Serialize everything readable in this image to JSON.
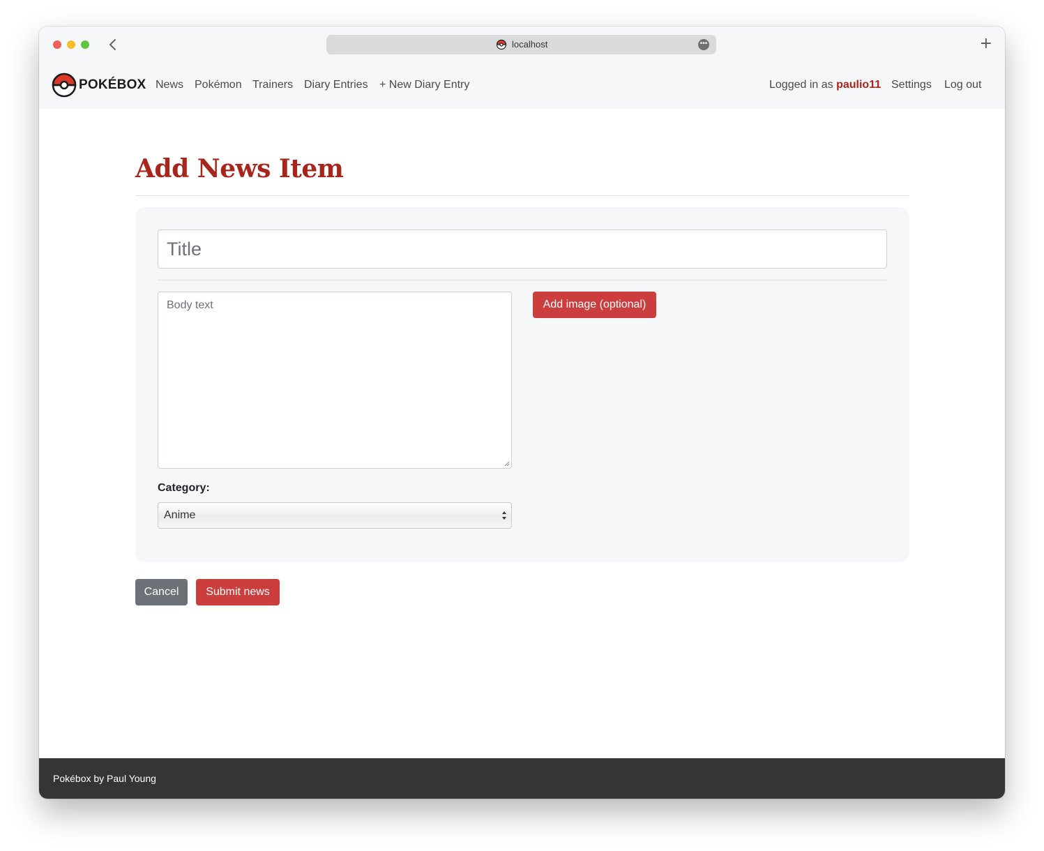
{
  "browser": {
    "url": "localhost",
    "new_tab_label": "+",
    "more_label": "•••"
  },
  "navbar": {
    "brand": "POKÉBOX",
    "links": [
      {
        "label": "News"
      },
      {
        "label": "Pokémon"
      },
      {
        "label": "Trainers"
      },
      {
        "label": "Diary Entries"
      },
      {
        "label": "New Diary Entry",
        "icon": "plus-icon",
        "prefix": "+"
      }
    ],
    "logged_in_prefix": "Logged in as",
    "username": "paulio11",
    "settings_label": "Settings",
    "logout_label": "Log out"
  },
  "page": {
    "title": "Add News Item"
  },
  "form": {
    "title_placeholder": "Title",
    "body_placeholder": "Body text",
    "add_image_label": "Add image (optional)",
    "category_label": "Category:",
    "category_selected": "Anime",
    "cancel_label": "Cancel",
    "submit_label": "Submit news"
  },
  "footer": {
    "text": "Pokébox by Paul Young"
  },
  "colors": {
    "brand_red": "#a8251b",
    "button_red": "#cc3d3e",
    "button_gray": "#6b7177",
    "footer_bg": "#353535",
    "navbar_bg": "#f6f7f8"
  }
}
